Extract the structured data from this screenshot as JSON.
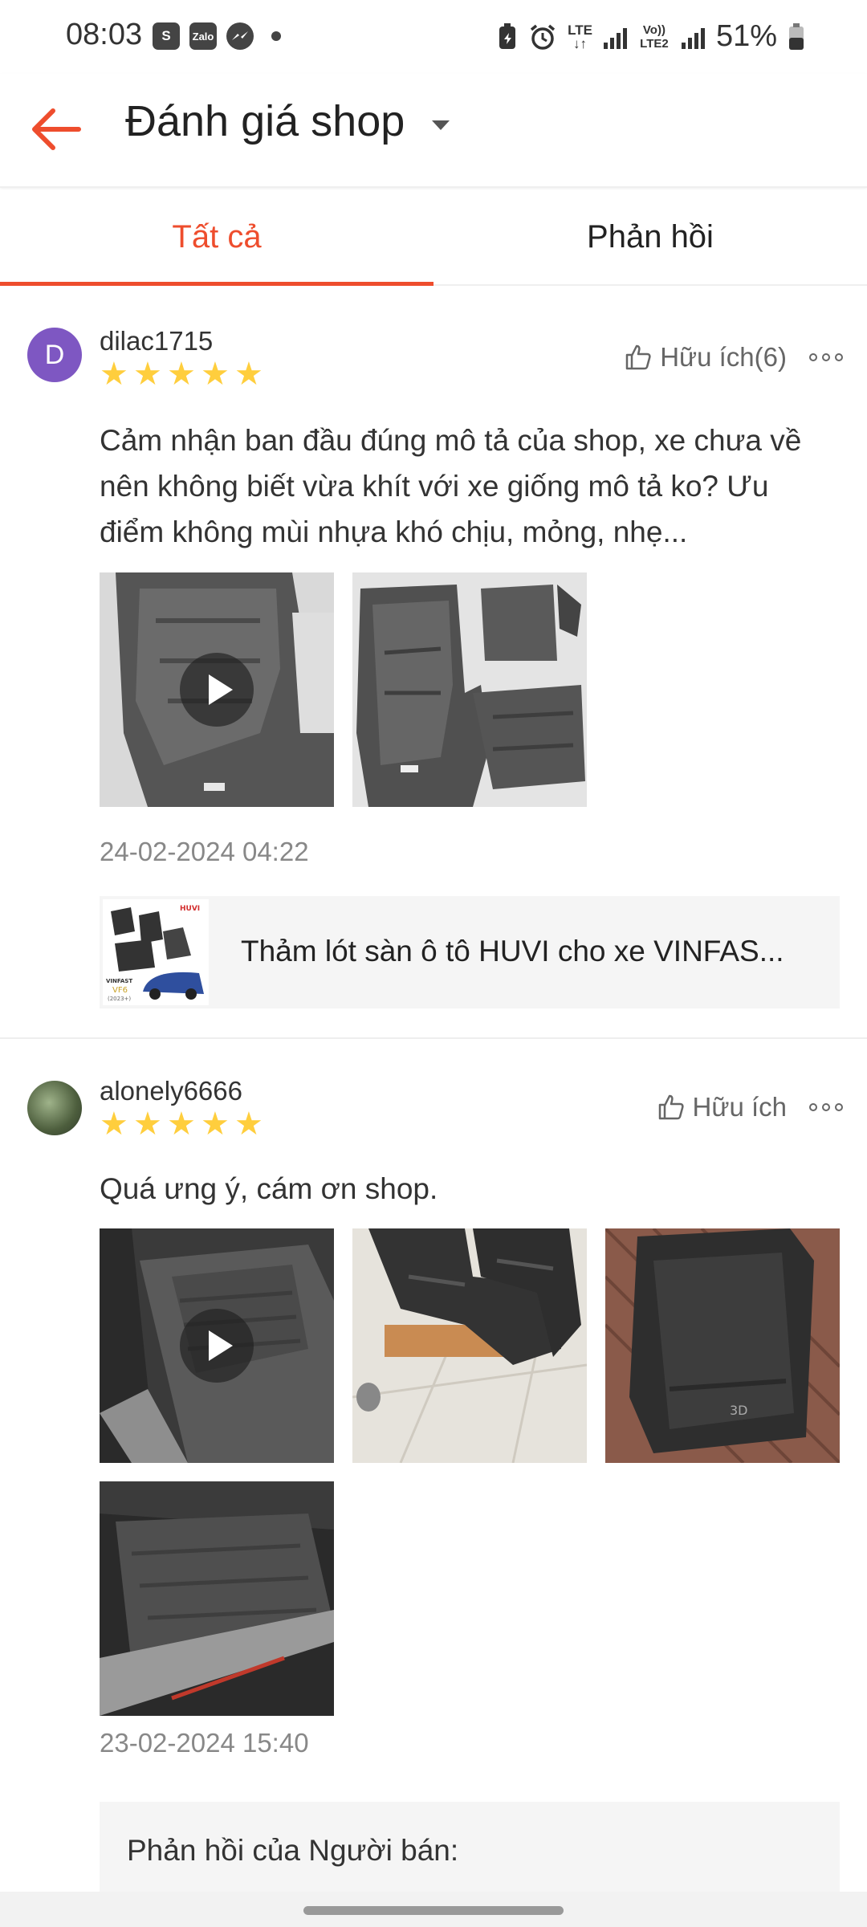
{
  "status_bar": {
    "time": "08:03",
    "left_icons": [
      "S",
      "Zalo",
      "messenger-icon"
    ],
    "network_lte": "LTE",
    "network_volte": "Vo)) LTE2",
    "battery": "51%"
  },
  "header": {
    "title": "Đánh giá shop"
  },
  "tabs": [
    {
      "label": "Tất cả",
      "active": true
    },
    {
      "label": "Phản hồi",
      "active": false
    }
  ],
  "reviews": [
    {
      "avatar_letter": "D",
      "username": "dilac1715",
      "rating": 5,
      "helpful_label": "Hữu ích(6)",
      "text": "Cảm nhận ban đầu đúng mô tả của shop, xe chưa về nên không biết vừa khít với xe giống mô tả ko? Ưu điểm không mùi nhựa khó chịu, mỏng, nhẹ...",
      "date": "24-02-2024 04:22",
      "product": {
        "name": "Thảm lót sàn ô tô HUVI cho xe VINFAS...",
        "thumb_brand": "HUVI",
        "thumb_label_1": "VINFAST",
        "thumb_label_2": "VF6",
        "thumb_label_3": "(2023+)"
      }
    },
    {
      "username": "alonely6666",
      "rating": 5,
      "helpful_label": "Hữu ích",
      "text": "Quá ưng ý, cám ơn shop.",
      "date": "23-02-2024 15:40",
      "seller_reply_title": "Phản hồi của Người bán:"
    }
  ],
  "colors": {
    "accent": "#ee4d2d",
    "star": "#ffce3d",
    "avatar": "#7e57c2"
  }
}
